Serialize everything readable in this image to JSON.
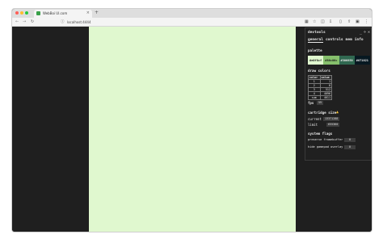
{
  "browser": {
    "tab_title": "WebBoi UI.com",
    "tab_close": "×",
    "new_tab": "+",
    "url": "localhost:4444",
    "nav": {
      "back": "←",
      "forward": "→",
      "reload": "↻"
    }
  },
  "devtools": {
    "title": "devtools",
    "controls": {
      "minimize": "_",
      "detach": "⋄",
      "close": "✕"
    },
    "tabs": [
      "general",
      "controls",
      "mem",
      "info"
    ],
    "palette": {
      "label": "palette",
      "swatches": [
        {
          "hex": "#e0f8cf",
          "text_color": "#1a1a1a"
        },
        {
          "hex": "#86c06c",
          "text_color": "#1a1a1a"
        },
        {
          "hex": "#306850",
          "text_color": "#e8e8e8"
        },
        {
          "hex": "#071821",
          "text_color": "#e8e8e8"
        }
      ]
    },
    "draw_colors": {
      "label": "draw colors",
      "header": [
        "color",
        "value"
      ],
      "rows": [
        {
          "color": "1",
          "value": "1"
        },
        {
          "color": "2",
          "value": "8"
        },
        {
          "color": "3",
          "value": "512"
        },
        {
          "color": "4",
          "value": "4096"
        },
        {
          "color": "sum",
          "value": "4611"
        }
      ]
    },
    "fps": {
      "label": "fps",
      "value": "59"
    },
    "cartridge": {
      "label": "cartridge size",
      "current_label": "current",
      "current_value": "13371288",
      "limit_label": "limit",
      "limit_value": "655360"
    },
    "system_flags": {
      "label": "system flags",
      "flags": [
        {
          "label": "preserve framebuffer",
          "value": "0"
        },
        {
          "label": "hide gamepad overlay",
          "value": "0"
        }
      ]
    }
  },
  "colors": {
    "canvas_bg": "#e0f8cf",
    "page_bg": "#1f1f1f",
    "warning": "#f2c037"
  }
}
